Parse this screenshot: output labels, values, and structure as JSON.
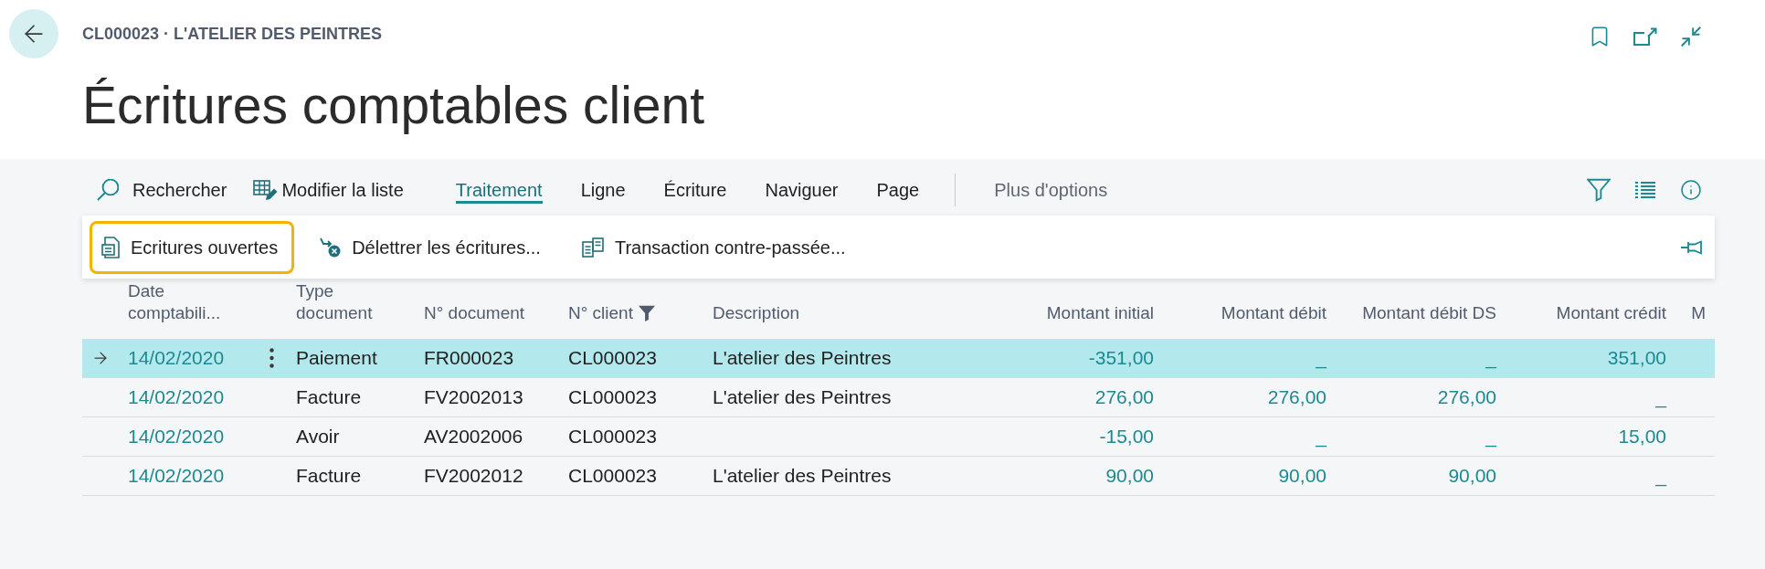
{
  "header": {
    "breadcrumb": "CL000023 · L'ATELIER DES PEINTRES",
    "title": "Écritures comptables client"
  },
  "action_bar": {
    "tools": [
      {
        "label": "Rechercher",
        "kind": "search"
      },
      {
        "label": "Modifier la liste",
        "kind": "edit_list"
      }
    ],
    "menus": [
      {
        "label": "Traitement",
        "selected": true
      },
      {
        "label": "Ligne",
        "selected": false
      },
      {
        "label": "Écriture",
        "selected": false
      },
      {
        "label": "Naviguer",
        "selected": false
      },
      {
        "label": "Page",
        "selected": false
      }
    ],
    "more_options": "Plus d'options"
  },
  "sub_actions": [
    {
      "label": "Ecritures ouvertes",
      "kind": "open_entries",
      "focused": true
    },
    {
      "label": "Délettrer les écritures...",
      "kind": "unapply",
      "focused": false
    },
    {
      "label": "Transaction contre-passée...",
      "kind": "reverse",
      "focused": false
    }
  ],
  "table": {
    "columns": [
      {
        "lines": [
          "Date",
          "comptabili..."
        ],
        "kind": "date",
        "filtered": false
      },
      {
        "lines": [
          "Type",
          "document"
        ],
        "kind": "text",
        "filtered": false
      },
      {
        "lines": [
          "N° document"
        ],
        "kind": "text",
        "filtered": false
      },
      {
        "lines": [
          "N° client"
        ],
        "kind": "text",
        "filtered": true
      },
      {
        "lines": [
          "Description"
        ],
        "kind": "text",
        "filtered": false
      },
      {
        "lines": [
          "Montant initial"
        ],
        "kind": "amount",
        "filtered": false
      },
      {
        "lines": [
          "Montant débit"
        ],
        "kind": "amount",
        "filtered": false
      },
      {
        "lines": [
          "Montant débit DS"
        ],
        "kind": "amount",
        "filtered": false
      },
      {
        "lines": [
          "Montant crédit"
        ],
        "kind": "amount",
        "filtered": false
      },
      {
        "lines": [
          "M"
        ],
        "kind": "amount",
        "filtered": false
      }
    ],
    "rows": [
      {
        "selected": true,
        "cells": [
          "14/02/2020",
          "Paiement",
          "FR000023",
          "CL000023",
          "L'atelier des Peintres",
          "-351,00",
          "_",
          "_",
          "351,00"
        ]
      },
      {
        "selected": false,
        "cells": [
          "14/02/2020",
          "Facture",
          "FV2002013",
          "CL000023",
          "L'atelier des Peintres",
          "276,00",
          "276,00",
          "276,00",
          "_"
        ]
      },
      {
        "selected": false,
        "cells": [
          "14/02/2020",
          "Avoir",
          "AV2002006",
          "CL000023",
          null,
          "-15,00",
          "_",
          "_",
          "15,00"
        ]
      },
      {
        "selected": false,
        "cells": [
          "14/02/2020",
          "Facture",
          "FV2002012",
          "CL000023",
          "L'atelier des Peintres",
          "90,00",
          "90,00",
          "90,00",
          "_"
        ]
      }
    ]
  }
}
